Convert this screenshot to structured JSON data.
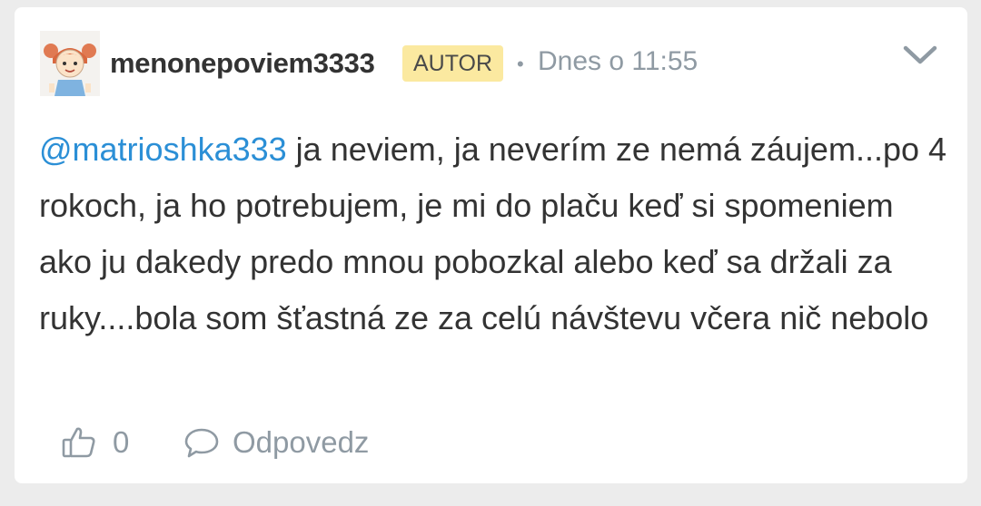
{
  "post": {
    "author": {
      "username": "menonepoviem3333",
      "badge": "AUTOR",
      "avatar_icon": "girl-avatar-icon"
    },
    "separator": "•",
    "timestamp": "Dnes o 11:55",
    "menu_icon": "chevron-down-icon",
    "mention": "@matrioshka333",
    "text": " ja neviem, ja neverím ze nemá záujem...po 4 rokoch, ja ho potrebujem, je mi do plaču keď si spomeniem ako ju dakedy predo mnou pobozkal alebo keď sa držali za ruky....bola som šťastná ze za celú návštevu včera nič nebolo",
    "actions": {
      "like_icon": "thumbs-up-icon",
      "like_count": "0",
      "reply_icon": "speech-bubble-icon",
      "reply_label": "Odpovedz"
    }
  },
  "colors": {
    "background": "#ececec",
    "card": "#ffffff",
    "text": "#333333",
    "muted": "#8f9aa3",
    "mention": "#2b8fd6",
    "badge": "#fbe9a0"
  }
}
